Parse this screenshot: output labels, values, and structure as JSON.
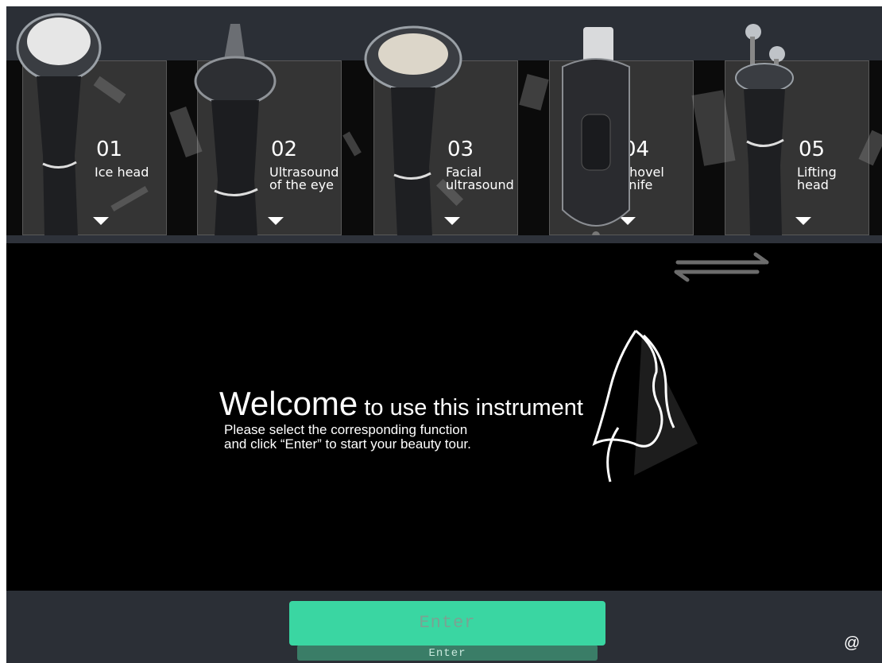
{
  "cards": [
    {
      "num": "01",
      "label_lines": [
        "Ice head"
      ]
    },
    {
      "num": "02",
      "label_lines": [
        "Ultrasound",
        "of the eye"
      ]
    },
    {
      "num": "03",
      "label_lines": [
        "Facial",
        "ultrasound"
      ]
    },
    {
      "num": "04",
      "label_lines": [
        "Shovel",
        "knife"
      ]
    },
    {
      "num": "05",
      "label_lines": [
        "Lifting",
        "head"
      ]
    }
  ],
  "welcome": {
    "big": "Welcome",
    "rest": " to use this instrument"
  },
  "subtitle": {
    "line1": "Please select the corresponding function",
    "line2": "and click “Enter” to start your beauty tour."
  },
  "enter_button": {
    "label": "Enter",
    "shadow_label": "Enter"
  },
  "corner_symbol": "@",
  "colors": {
    "accent": "#3ad6a2",
    "bar": "#2b2f36",
    "background": "#000000"
  },
  "icons": {
    "swipe": "swipe-arrows-icon",
    "card_arrow": "triangle-down-icon",
    "face": "face-outline-icon"
  }
}
